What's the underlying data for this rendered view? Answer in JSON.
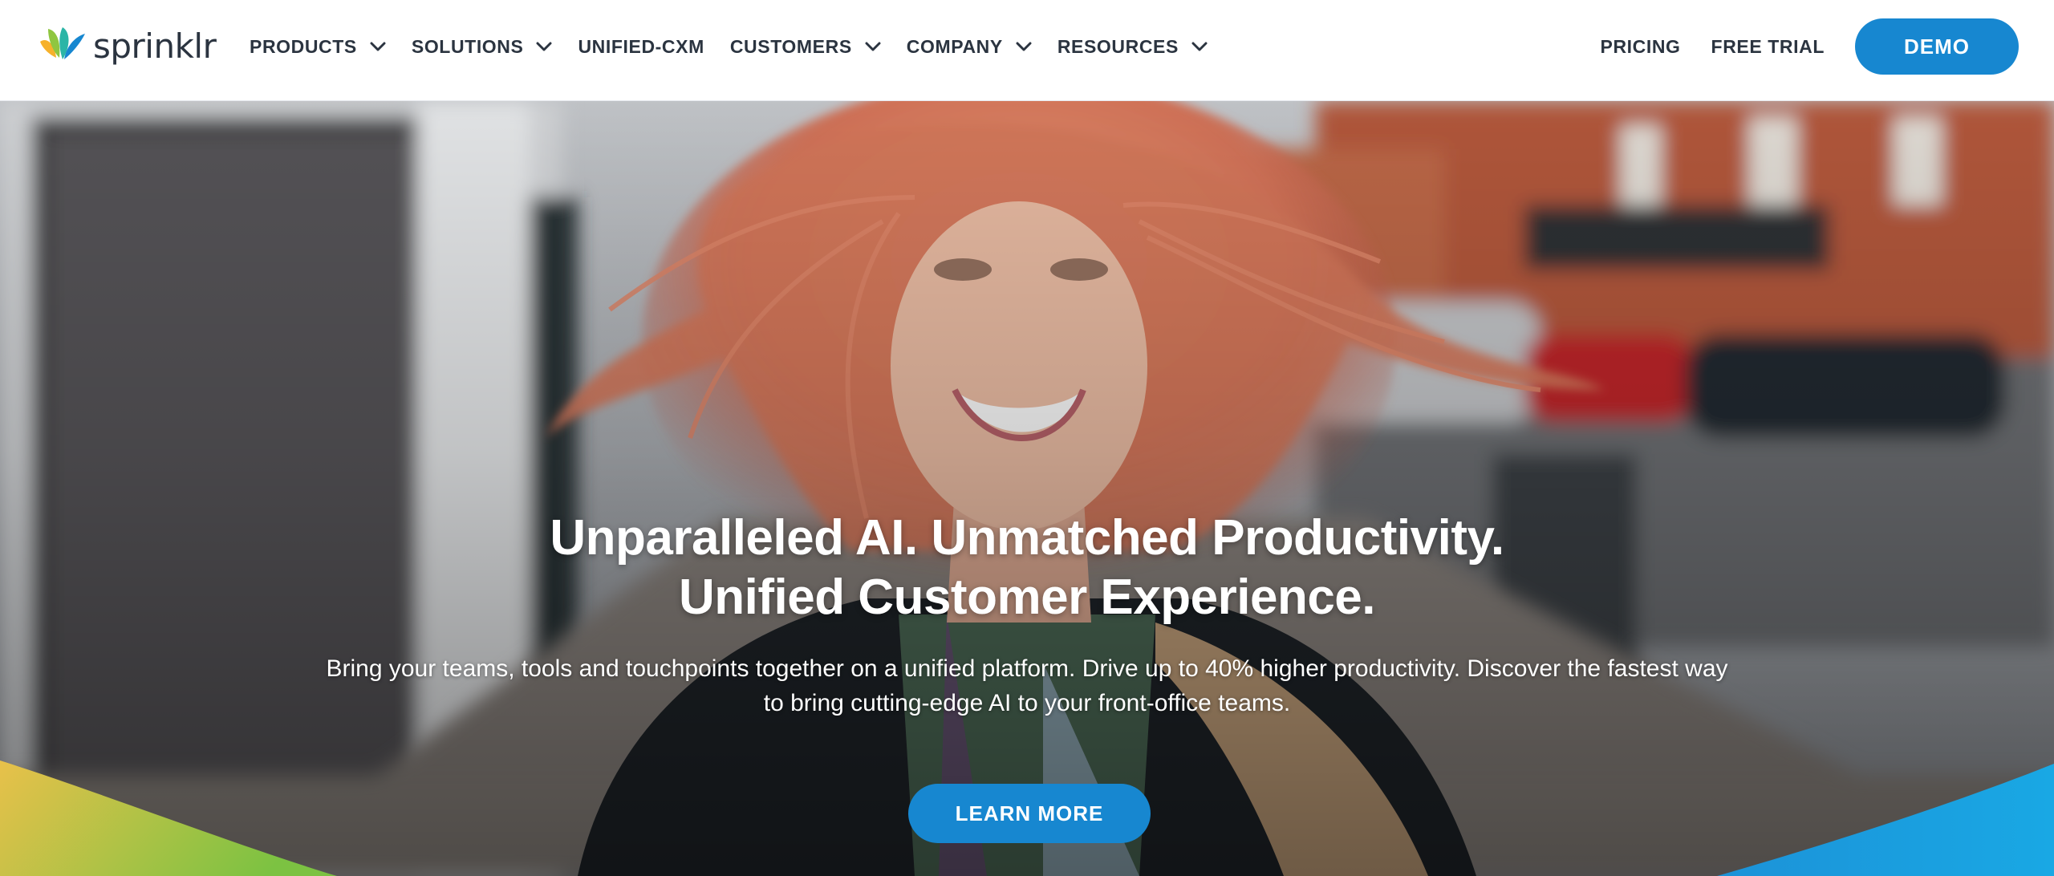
{
  "brand": {
    "name": "sprinklr",
    "logo_colors": [
      "#f6b12b",
      "#8fc640",
      "#2bb5a6",
      "#1787d0"
    ]
  },
  "nav": {
    "items": [
      {
        "label": "PRODUCTS",
        "has_dropdown": true
      },
      {
        "label": "SOLUTIONS",
        "has_dropdown": true
      },
      {
        "label": "UNIFIED-CXM",
        "has_dropdown": false
      },
      {
        "label": "CUSTOMERS",
        "has_dropdown": true
      },
      {
        "label": "COMPANY",
        "has_dropdown": true
      },
      {
        "label": "RESOURCES",
        "has_dropdown": true
      }
    ],
    "pricing": "PRICING",
    "free_trial": "FREE TRIAL",
    "demo": "DEMO"
  },
  "hero": {
    "title_line1": "Unparalleled AI. Unmatched Productivity.",
    "title_line2": "Unified Customer Experience.",
    "subtitle_line1": "Bring your teams, tools and touchpoints together on a unified platform. Drive up to 40% higher productivity. Discover the fastest way",
    "subtitle_line2": "to bring cutting-edge AI to your front-office teams.",
    "cta": "LEARN MORE",
    "image": "photo of smiling woman with windblown pink-orange hair on a city street"
  },
  "colors": {
    "accent": "#1787d0",
    "nav_text": "#2b3440",
    "wave_left_start": "#e8c14a",
    "wave_left_end": "#7cc242",
    "wave_right": "#1aa0e0"
  }
}
